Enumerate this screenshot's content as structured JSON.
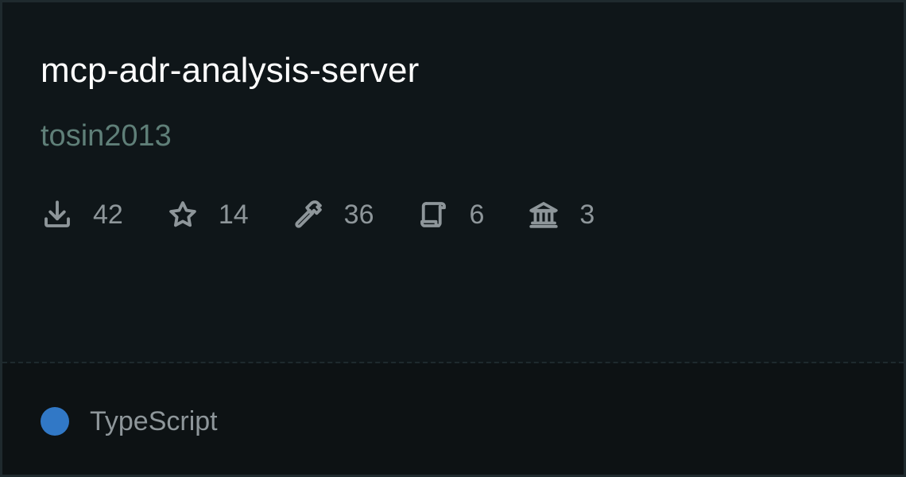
{
  "card": {
    "title": "mcp-adr-analysis-server",
    "author": "tosin2013",
    "stats": [
      {
        "icon": "download-icon",
        "value": "42"
      },
      {
        "icon": "star-icon",
        "value": "14"
      },
      {
        "icon": "hammer-icon",
        "value": "36"
      },
      {
        "icon": "scroll-icon",
        "value": "6"
      },
      {
        "icon": "bank-icon",
        "value": "3"
      }
    ],
    "language": {
      "label": "TypeScript",
      "color": "#3178c6"
    }
  }
}
